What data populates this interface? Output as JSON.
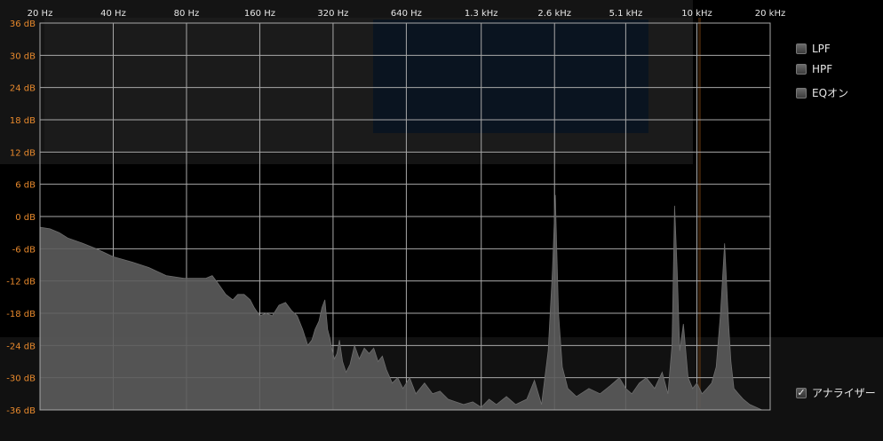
{
  "chart_data": {
    "type": "area",
    "title": "",
    "xlabel": "",
    "ylabel": "",
    "x_scale": "log",
    "xlim": [
      20,
      20000
    ],
    "ylim": [
      -36,
      36
    ],
    "x_ticks": [
      20,
      40,
      80,
      160,
      320,
      640,
      1300,
      2600,
      5100,
      10000,
      20000
    ],
    "x_tick_labels": [
      "20 Hz",
      "40 Hz",
      "80 Hz",
      "160 Hz",
      "320 Hz",
      "640 Hz",
      "1.3 kHz",
      "2.6 kHz",
      "5.1 kHz",
      "10 kHz",
      "20 kHz"
    ],
    "y_ticks": [
      36,
      30,
      24,
      18,
      12,
      6,
      0,
      -6,
      -12,
      -18,
      -24,
      -30,
      -36
    ],
    "y_tick_labels": [
      "36 dB",
      "30 dB",
      "24 dB",
      "18 dB",
      "12 dB",
      "6 dB",
      "0 dB",
      "-6 dB",
      "-12 dB",
      "-18 dB",
      "-24 dB",
      "-30 dB",
      "-36 dB"
    ],
    "grid": true,
    "colors": {
      "spectrum": "#5c5c5c",
      "grid": "#a8a8a8",
      "y_tick_label": "#e8892c",
      "x_tick_label": "#e6e6e6"
    },
    "series": [
      {
        "x": [
          20,
          22,
          24,
          26,
          30,
          34,
          40,
          48,
          56,
          66,
          78,
          88,
          96,
          102,
          108,
          116,
          124,
          130,
          138,
          146,
          152,
          160,
          170,
          180,
          192,
          204,
          216,
          228,
          240,
          252,
          262,
          270,
          280,
          288,
          296,
          304,
          310,
          316,
          324,
          332,
          340,
          350,
          362,
          376,
          392,
          410,
          430,
          450,
          470,
          490,
          510,
          530,
          560,
          590,
          620,
          660,
          700,
          760,
          820,
          880,
          950,
          1020,
          1100,
          1200,
          1300,
          1400,
          1500,
          1650,
          1800,
          2000,
          2150,
          2300,
          2450,
          2550,
          2620,
          2700,
          2800,
          2950,
          3200,
          3600,
          4000,
          4400,
          4800,
          5100,
          5400,
          5800,
          6200,
          6700,
          7200,
          7600,
          7900,
          8100,
          8300,
          8500,
          8800,
          9200,
          9600,
          10000,
          10500,
          11000,
          11500,
          12000,
          12500,
          13000,
          13500,
          13800,
          14200,
          14800,
          15500,
          16500,
          17500,
          18500,
          19300,
          20000
        ],
        "values": [
          -2,
          -2.3,
          -3,
          -4,
          -5,
          -6,
          -7.5,
          -8.5,
          -9.5,
          -11,
          -11.5,
          -11.5,
          -11.5,
          -11,
          -12.5,
          -14.5,
          -15.5,
          -14.5,
          -14.5,
          -15.5,
          -17,
          -18.5,
          -18,
          -18.5,
          -16.5,
          -16,
          -17.5,
          -18.5,
          -21,
          -24,
          -23,
          -21,
          -19.5,
          -17,
          -15.5,
          -21,
          -22.5,
          -24.5,
          -26.5,
          -25.5,
          -23,
          -27,
          -29,
          -27.5,
          -24,
          -26.5,
          -24.5,
          -25.5,
          -24.5,
          -27,
          -26,
          -28.5,
          -31,
          -30,
          -32,
          -30,
          -33,
          -31,
          -33,
          -32.5,
          -34,
          -34.5,
          -35,
          -34.5,
          -35.5,
          -34,
          -35,
          -33.5,
          -35,
          -34,
          -30.5,
          -35,
          -25,
          -10,
          4,
          -18,
          -28,
          -32,
          -33.5,
          -32,
          -33,
          -31.5,
          -30,
          -32,
          -33,
          -31,
          -30,
          -32,
          -29,
          -33,
          -24,
          2,
          -10,
          -25,
          -20,
          -30,
          -32,
          -31,
          -33,
          -32,
          -31,
          -28,
          -18,
          -5,
          -20,
          -27,
          -32,
          -33,
          -34,
          -35,
          -35.5,
          -36,
          -36,
          -36
        ]
      }
    ]
  },
  "options": {
    "lpf": {
      "label": "LPF",
      "checked": false
    },
    "hpf": {
      "label": "HPF",
      "checked": false
    },
    "eq": {
      "label": "EQオン",
      "checked": false
    },
    "analyzer": {
      "label": "アナライザー",
      "checked": true,
      "check_glyph": "✓"
    }
  }
}
